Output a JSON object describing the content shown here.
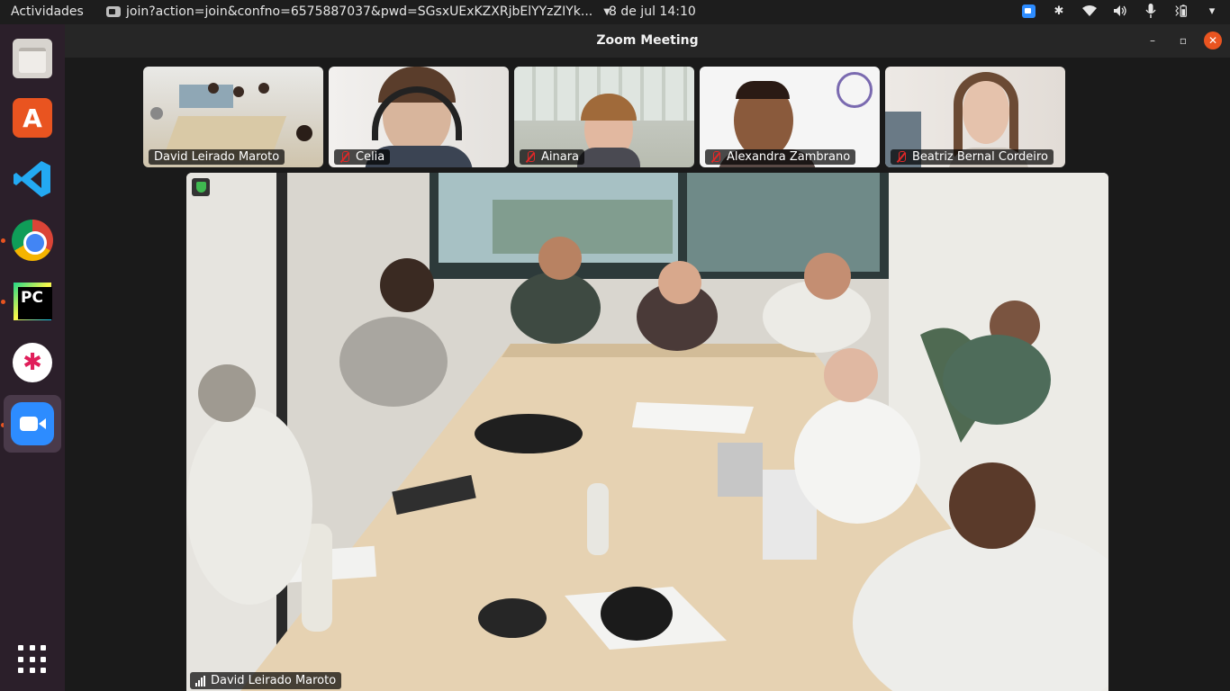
{
  "topbar": {
    "activities": "Actividades",
    "app_window_title": "join?action=join&confno=6575887037&pwd=SGsxUExKZXRjbElYYzZIYk...",
    "clock": "8 de jul  14:10"
  },
  "window": {
    "title": "Zoom Meeting"
  },
  "participants": [
    {
      "name": "David Leirado Maroto"
    },
    {
      "name": "Celia"
    },
    {
      "name": "Ainara"
    },
    {
      "name": "Alexandra Zambrano"
    },
    {
      "name": "Beatriz Bernal Cordeiro"
    }
  ],
  "main_video": {
    "speaker_name": "David Leirado Maroto"
  },
  "colors": {
    "dock_bg": "#2b1f2a",
    "topbar_bg": "#1d1d1d",
    "zoom_blue": "#2d8cff",
    "ubuntu_orange": "#e95420",
    "mute_red": "#e02828"
  }
}
